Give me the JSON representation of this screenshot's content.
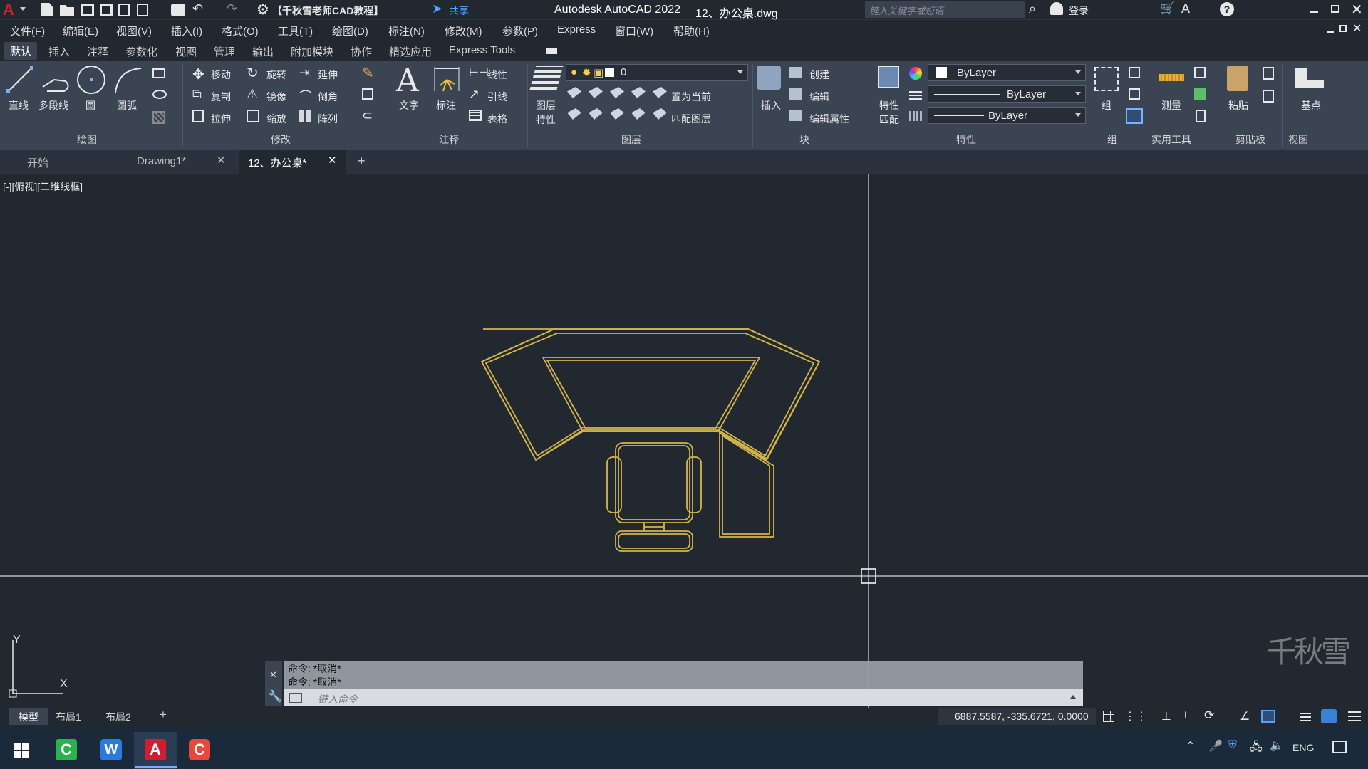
{
  "app": {
    "title": "Autodesk AutoCAD 2022",
    "document": "12、办公桌.dwg",
    "workspace": "【千秋雪老师CAD教程】",
    "share": "共享",
    "search_placeholder": "键入关键字或短语",
    "login": "登录"
  },
  "menubar": [
    "文件(F)",
    "编辑(E)",
    "视图(V)",
    "插入(I)",
    "格式(O)",
    "工具(T)",
    "绘图(D)",
    "标注(N)",
    "修改(M)",
    "参数(P)",
    "Express",
    "窗口(W)",
    "帮助(H)"
  ],
  "ribbon_tabs": [
    "默认",
    "插入",
    "注释",
    "参数化",
    "视图",
    "管理",
    "输出",
    "附加模块",
    "协作",
    "精选应用",
    "Express Tools"
  ],
  "ribbon": {
    "draw": {
      "line": "直线",
      "polyline": "多段线",
      "circle": "圆",
      "arc": "圆弧",
      "title": "绘图"
    },
    "modify": {
      "move": "移动",
      "rotate": "旋转",
      "extend": "延伸",
      "copy": "复制",
      "mirror": "镜像",
      "chamfer": "倒角",
      "stretch": "拉伸",
      "scale": "缩放",
      "array": "阵列",
      "title": "修改"
    },
    "annotation": {
      "text": "文字",
      "dim": "标注",
      "linear": "线性",
      "leader": "引线",
      "table": "表格",
      "title": "注释"
    },
    "layers": {
      "layer_props_1": "图层",
      "layer_props_2": "特性",
      "current_layer": "0",
      "set_current": "置为当前",
      "match_layer": "匹配图层",
      "title": "图层"
    },
    "block": {
      "insert": "插入",
      "create": "创建",
      "edit": "编辑",
      "edit_attr": "编辑属性",
      "title": "块"
    },
    "properties": {
      "match_1": "特性",
      "match_2": "匹配",
      "color": "ByLayer",
      "linetype": "ByLayer",
      "lineweight": "ByLayer",
      "title": "特性"
    },
    "groups": {
      "group": "组",
      "title": "组"
    },
    "utilities": {
      "measure": "测量",
      "title": "实用工具"
    },
    "clipboard": {
      "paste": "粘贴",
      "title": "剪贴板"
    },
    "view": {
      "base": "基点",
      "title": "视图"
    }
  },
  "doc_tabs": [
    {
      "label": "开始"
    },
    {
      "label": "Drawing1*"
    },
    {
      "label": "12、办公桌*"
    }
  ],
  "viewport_label": "[-][俯视][二维线框]",
  "ucs": {
    "x": "X",
    "y": "Y"
  },
  "command_history": [
    "命令: *取消*",
    "命令: *取消*"
  ],
  "command_placeholder": "键入命令",
  "layout_tabs": [
    "模型",
    "布局1",
    "布局2"
  ],
  "coordinates": "6887.5587, -335.6721, 0.0000",
  "watermark": "千秋雪",
  "taskbar": {
    "lang": "ENG"
  },
  "colors": {
    "accent": "#d4b44a",
    "canvas": "#212830",
    "ribbon": "#3b4453",
    "crosshair": "#ffffff"
  }
}
